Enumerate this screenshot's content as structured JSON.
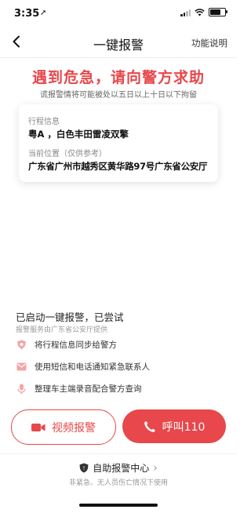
{
  "status_bar": {
    "time": "3:35",
    "location_glyph": "➚"
  },
  "nav": {
    "title": "一键报警",
    "help_label": "功能说明"
  },
  "warning": {
    "title": "遇到危急，请向警方求助",
    "subtitle": "谎报警情将可能被处以五日以上十日以下拘留"
  },
  "trip_card": {
    "trip_label": "行程信息",
    "trip_value": "粤A ，白色丰田雷凌双擎",
    "location_label": "当前位置（仅供参考）",
    "location_value": "广东省广州市越秀区黄华路97号广东省公安厅"
  },
  "alarm_status": {
    "title": "已启动一键报警，已尝试",
    "provider": "报警服务由广东省公安厅提供",
    "items": [
      {
        "icon": "police-badge-icon",
        "text": "将行程信息同步给警方"
      },
      {
        "icon": "message-icon",
        "text": "使用短信和电话通知紧急联系人"
      },
      {
        "icon": "microphone-icon",
        "text": "整理车主端录音配合警方查询"
      }
    ]
  },
  "actions": {
    "video_label": "视频报警",
    "call_label": "呼叫110"
  },
  "self_help": {
    "title": "自助报警中心",
    "chevron": "›",
    "subtitle": "非紧急、无人员伤亡情况下使用"
  },
  "colors": {
    "accent": "#e8474b",
    "text_primary": "#222222",
    "text_secondary": "#999999"
  }
}
